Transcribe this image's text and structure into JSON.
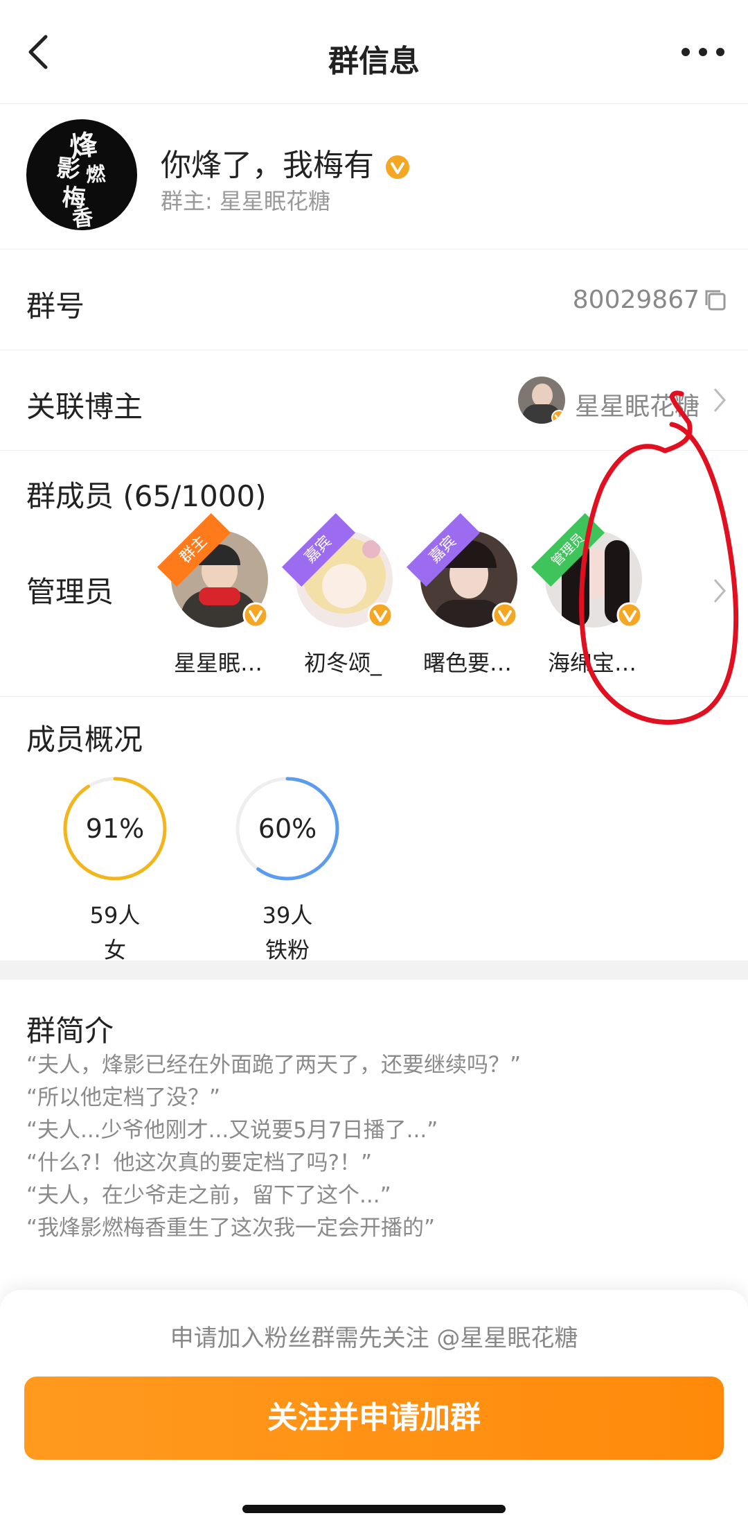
{
  "nav": {
    "title": "群信息"
  },
  "header": {
    "group_name": "你烽了，我梅有",
    "owner_text": "群主: 星星眠花糖",
    "avatar_text": [
      "烽",
      "影",
      "燃",
      "梅",
      "香"
    ]
  },
  "group_id": {
    "label": "群号",
    "value": "80029867"
  },
  "blogger": {
    "label": "关联博主",
    "name": "星星眠花糖"
  },
  "members": {
    "count_label": "群成员 (65/1000)",
    "admin_label": "管理员",
    "admins": [
      {
        "name": "星星眠…",
        "tag": "群主",
        "tag_color": "#ff7a1a"
      },
      {
        "name": "初冬颂_",
        "tag": "嘉宾",
        "tag_color": "#9c6cf0"
      },
      {
        "name": "曙色要…",
        "tag": "嘉宾",
        "tag_color": "#9c6cf0"
      },
      {
        "name": "海绵宝…",
        "tag": "管理员",
        "tag_color": "#3ec45a"
      }
    ]
  },
  "overview": {
    "title": "成员概况",
    "stats": [
      {
        "percent": "91%",
        "count": "59人",
        "label": "女",
        "value": 0.91,
        "color": "#f2b51c"
      },
      {
        "percent": "60%",
        "count": "39人",
        "label": "铁粉",
        "value": 0.6,
        "color": "#5b9cf0"
      }
    ]
  },
  "intro": {
    "title": "群简介",
    "lines": [
      "“夫人，烽影已经在外面跪了两天了，还要继续吗？”",
      "“所以他定档了没？”",
      "“夫人...少爷他刚才...又说要5月7日播了...”",
      "“什么?！他这次真的要定档了吗?！”",
      "“夫人，在少爷走之前，留下了这个...”",
      "“我烽影燃梅香重生了这次我一定会开播的”"
    ]
  },
  "bottom": {
    "notice": "申请加入粉丝群需先关注 @星星眠花糖",
    "join_label": "关注并申请加群"
  },
  "colors": {
    "accent": "#ff8f12",
    "verify_badge": "#f5a623",
    "annotation": "#e01020"
  }
}
